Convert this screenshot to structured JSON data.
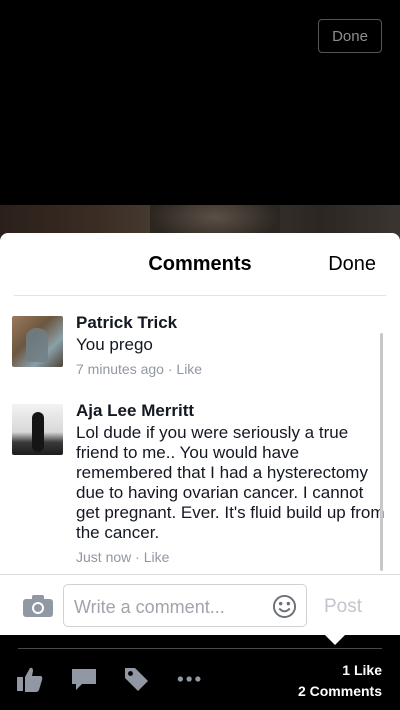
{
  "top_bar": {
    "done_label": "Done"
  },
  "sheet": {
    "title": "Comments",
    "done_label": "Done",
    "comments": [
      {
        "name": "Patrick Trick",
        "text": "You prego",
        "time": "7 minutes ago",
        "sep": " · ",
        "like": "Like"
      },
      {
        "name": "Aja Lee Merritt",
        "text": "Lol dude if you were seriously a true friend to me.. You would have remembered that I had a hysterectomy due to having ovarian cancer. I cannot get pregnant. Ever. It's fluid build up from the cancer.",
        "time": "Just now",
        "sep": " · ",
        "like": "Like"
      }
    ]
  },
  "composer": {
    "placeholder": "Write a comment...",
    "post_label": "Post",
    "icons": [
      "camera-icon",
      "emoji-icon"
    ]
  },
  "photo_toolbar": {
    "icons": [
      "like-icon",
      "comment-icon",
      "tag-icon",
      "more-icon"
    ],
    "likes": "1 Like",
    "comments": "2 Comments"
  }
}
